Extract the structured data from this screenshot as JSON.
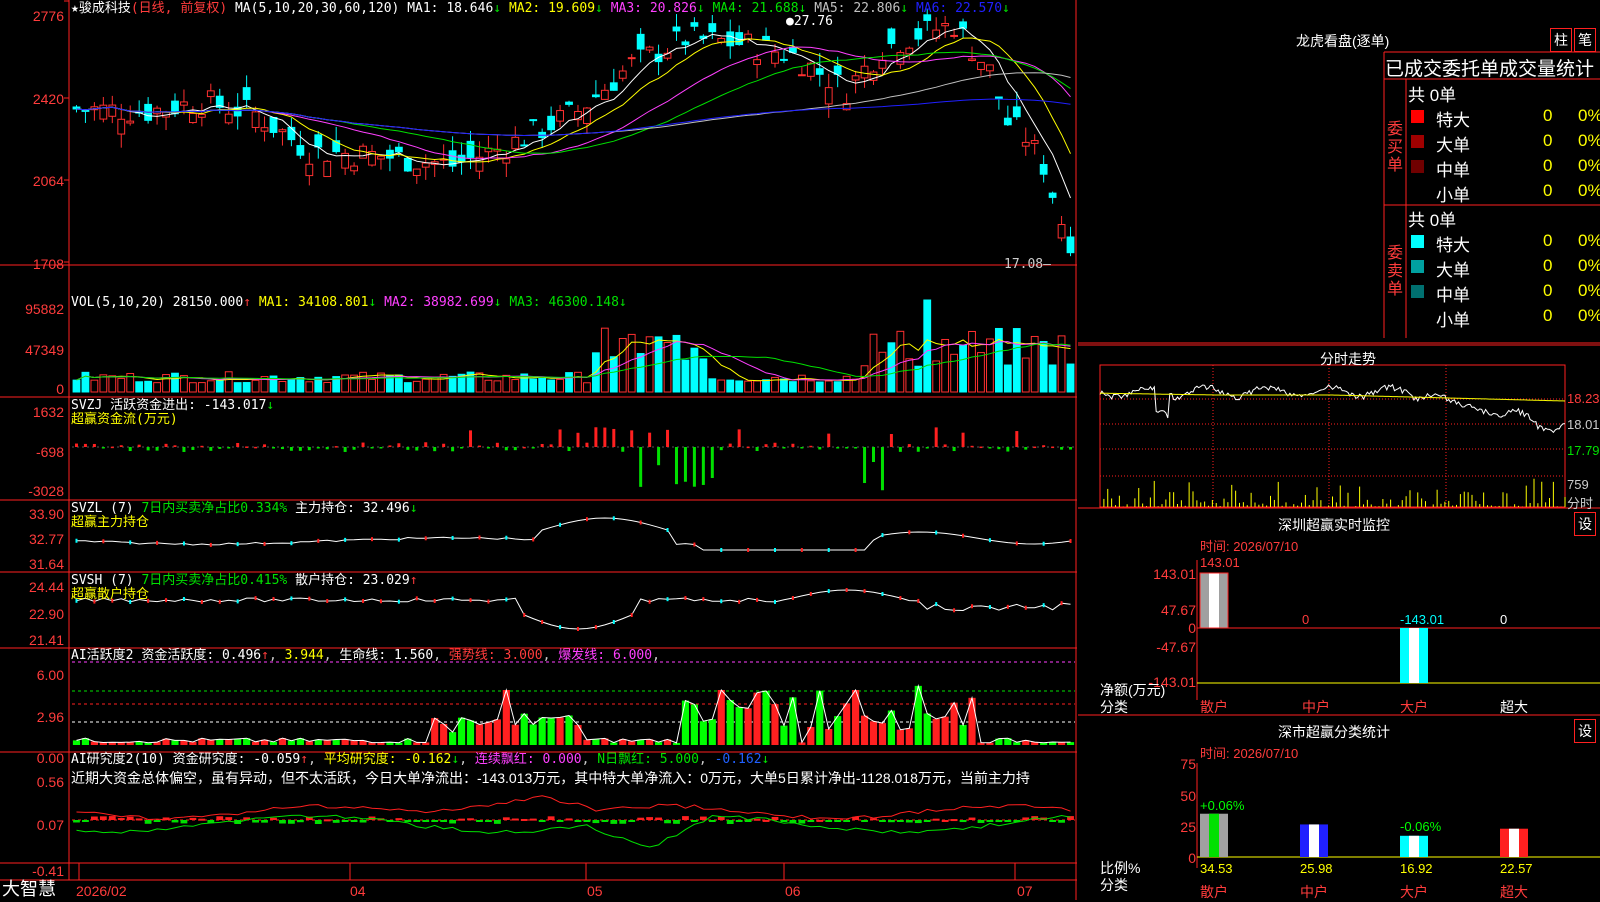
{
  "stock": {
    "name": "骏成科技",
    "mode": "(日线, 前复权)",
    "ma_params": "MA(5,10,20,30,60,120)"
  },
  "main_chart": {
    "y_ticks": [
      "2776",
      "2420",
      "2064",
      "1708"
    ],
    "ma": [
      {
        "label": "MA1:",
        "value": "18.646",
        "arrow": "↓",
        "color": "#ffffff"
      },
      {
        "label": "MA2:",
        "value": "19.609",
        "arrow": "↓",
        "color": "#ffff00"
      },
      {
        "label": "MA3:",
        "value": "20.826",
        "arrow": "↓",
        "color": "#ff40ff"
      },
      {
        "label": "MA4:",
        "value": "21.688",
        "arrow": "↓",
        "color": "#00e000"
      },
      {
        "label": "MA5:",
        "value": "22.806",
        "arrow": "↓",
        "color": "#c0c0c0"
      },
      {
        "label": "MA6:",
        "value": "22.570",
        "arrow": "↓",
        "color": "#2020ff"
      }
    ],
    "high_label": "27.76",
    "low_label": "17.08"
  },
  "vol_panel": {
    "title": "VOL(5,10,20)",
    "value": "28150.000",
    "arrow": "↑",
    "ma": [
      {
        "label": "MA1:",
        "value": "34108.801",
        "arrow": "↓",
        "color": "#ffff00"
      },
      {
        "label": "MA2:",
        "value": "38982.699",
        "arrow": "↓",
        "color": "#ff40ff"
      },
      {
        "label": "MA3:",
        "value": "46300.148",
        "arrow": "↓",
        "color": "#00e000"
      }
    ],
    "y_ticks": [
      "95882",
      "47349",
      "0"
    ]
  },
  "svzj_panel": {
    "title": "SVZJ",
    "label": "活跃资金进出:",
    "value": "-143.017",
    "arrow": "↓",
    "subtitle": "超赢资金流(万元)",
    "y_ticks": [
      "1632",
      "-698",
      "-3028"
    ]
  },
  "svzl_panel": {
    "title": "SVZL (7)",
    "label1": "7日内买卖净占比0.334%",
    "label2": "主力持仓:",
    "value": "32.496",
    "arrow": "↓",
    "subtitle": "超赢主力持仓",
    "y_ticks": [
      "33.90",
      "32.77",
      "31.64"
    ]
  },
  "svsh_panel": {
    "title": "SVSH (7)",
    "label1": "7日内买卖净占比0.415%",
    "label2": "散户持仓:",
    "value": "23.029",
    "arrow": "↑",
    "subtitle": "超赢散户持仓",
    "y_ticks": [
      "24.44",
      "22.90",
      "21.41"
    ]
  },
  "ai_active_panel": {
    "title": "AI活跃度2",
    "label": "资金活跃度:",
    "value": "0.496",
    "value2": "3.944",
    "life_label": "生命线:",
    "life_value": "1.560",
    "strong_label": "强势线:",
    "strong_value": "3.000",
    "burst_label": "爆发线:",
    "burst_value": "6.000",
    "y_ticks": [
      "6.00",
      "2.96",
      "0.00"
    ]
  },
  "ai_research_panel": {
    "title": "AI研究度2(10)",
    "label": "资金研究度:",
    "value": "-0.059",
    "avg_label": "平均研究度:",
    "avg_value": "-0.162",
    "red_label": "连续飘红:",
    "red_value": "0.000",
    "n_label": "N日飘红:",
    "n_value": "5.000",
    "n_value2": "-0.162",
    "description": "近期大资金总体偏空，虽有异动，但不太活跃，今日大单净流出：-143.013万元，其中特大单净流入：0万元，大单5日累计净出-1128.018万元，当前主力持",
    "y_ticks": [
      "0.56",
      "0.07",
      "-0.41"
    ]
  },
  "bottom_bar": {
    "brand": "大智慧",
    "dates": [
      "2026/02",
      "04",
      "05",
      "06",
      "07"
    ]
  },
  "dragon_tiger": {
    "title": "龙虎看盘(逐单)",
    "btn1": "柱",
    "btn2": "笔",
    "header": "已成交委托单成交量统计",
    "buy": {
      "side": "委买单",
      "total": "共 0单",
      "rows": [
        {
          "label": "特大",
          "count": "0",
          "pct": "0%",
          "color": "#ff0000"
        },
        {
          "label": "大单",
          "count": "0",
          "pct": "0%",
          "color": "#a00000"
        },
        {
          "label": "中单",
          "count": "0",
          "pct": "0%",
          "color": "#700000"
        },
        {
          "label": "小单",
          "count": "0",
          "pct": "0%",
          "color": ""
        }
      ]
    },
    "sell": {
      "side": "委卖单",
      "total": "共 0单",
      "rows": [
        {
          "label": "特大",
          "count": "0",
          "pct": "0%",
          "color": "#00ffff"
        },
        {
          "label": "大单",
          "count": "0",
          "pct": "0%",
          "color": "#00a0a0"
        },
        {
          "label": "中单",
          "count": "0",
          "pct": "0%",
          "color": "#007070"
        },
        {
          "label": "小单",
          "count": "0",
          "pct": "0%",
          "color": ""
        }
      ]
    }
  },
  "intraday": {
    "title": "分时走势",
    "prices": [
      "18.23",
      "18.01",
      "17.79"
    ],
    "vol": "759",
    "vol_label": "分时"
  },
  "sz_monitor": {
    "title": "深圳超赢实时监控",
    "settings": "设",
    "time_label": "时间: 2026/07/10",
    "y_ticks": [
      "143.01",
      "47.67",
      "0",
      "-47.67",
      "-143.01"
    ],
    "values": [
      "143.01",
      "0",
      "-143.01",
      "0"
    ],
    "axis_label": "净额(万元)",
    "cat_label": "分类",
    "categories": [
      "散户",
      "中户",
      "大户",
      "超大"
    ]
  },
  "sz_classify": {
    "title": "深市超赢分类统计",
    "settings": "设",
    "time_label": "时间: 2026/07/10",
    "y_ticks": [
      "75",
      "50",
      "25",
      "0"
    ],
    "bars": [
      {
        "cat": "散户",
        "value": "34.53",
        "delta": "+0.06%"
      },
      {
        "cat": "中户",
        "value": "25.98",
        "delta": ""
      },
      {
        "cat": "大户",
        "value": "16.92",
        "delta": "-0.06%"
      },
      {
        "cat": "超大",
        "value": "22.57",
        "delta": ""
      }
    ],
    "axis_label": "比例%",
    "cat_label": "分类"
  }
}
